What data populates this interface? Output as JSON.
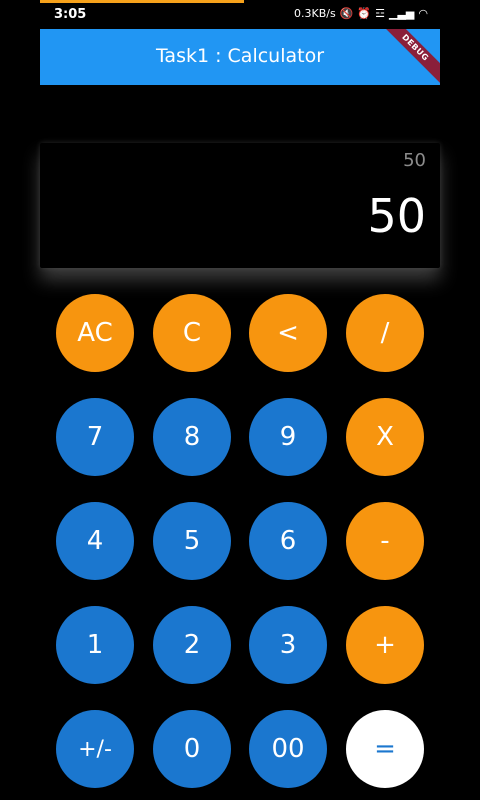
{
  "status_bar": {
    "time": "3:05",
    "speed": "0.3KB/s",
    "icons": [
      "mute-icon",
      "alarm-icon",
      "vibrate-icon",
      "signal-icon",
      "wifi-icon"
    ]
  },
  "app_bar": {
    "title": "Task1 : Calculator",
    "debug_label": "DEBUG"
  },
  "display": {
    "equation": "50",
    "result": "50"
  },
  "keypad": {
    "row1": [
      "AC",
      "C",
      "<",
      "/"
    ],
    "row2": [
      "7",
      "8",
      "9",
      "X"
    ],
    "row3": [
      "4",
      "5",
      "6",
      "-"
    ],
    "row4": [
      "1",
      "2",
      "3",
      "+"
    ],
    "row5": [
      "+/-",
      "0",
      "00",
      "="
    ]
  },
  "colors": {
    "app_bar": "#2196f3",
    "operator_button": "#f7950f",
    "number_button": "#1b77cf",
    "equals_button": "#ffffff",
    "background": "#000000"
  }
}
